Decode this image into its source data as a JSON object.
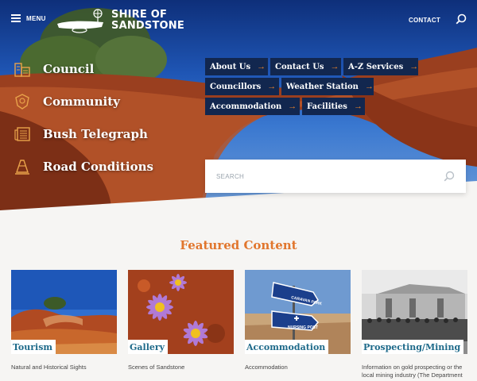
{
  "header": {
    "menu_label": "MENU",
    "logo_line1": "SHIRE OF",
    "logo_line2": "SANDSTONE",
    "contact_label": "CONTACT",
    "search_icon": "search-icon",
    "menu_icon": "hamburger-icon"
  },
  "quicknav": [
    {
      "label": "Council",
      "icon": "building-icon"
    },
    {
      "label": "Community",
      "icon": "community-emblem-icon"
    },
    {
      "label": "Bush Telegraph",
      "icon": "newspaper-icon"
    },
    {
      "label": "Road Conditions",
      "icon": "traffic-cone-icon"
    }
  ],
  "links": {
    "row1": [
      "About Us",
      "Contact Us",
      "A-Z Services"
    ],
    "row2": [
      "Councillors",
      "Weather Station"
    ],
    "row3": [
      "Accommodation",
      "Facilities"
    ],
    "arrow": "→"
  },
  "search": {
    "placeholder": "SEARCH"
  },
  "featured": {
    "title": "Featured Content",
    "cards": [
      {
        "label": "Tourism",
        "desc": "Natural and Historical Sights"
      },
      {
        "label": "Gallery",
        "desc": "Scenes of Sandstone"
      },
      {
        "label": "Accommodation",
        "desc": "Accommodation"
      },
      {
        "label": "Prospecting/Mining",
        "desc": "Information on gold prospecting or the local mining industry (The Department"
      }
    ]
  },
  "signs": {
    "caravan": "CARAVAN PARK",
    "nursing": "NURSING POST"
  },
  "colors": {
    "accent": "#e1762d",
    "nav_bg": "#12274f",
    "card_label": "#1e6a8a"
  }
}
